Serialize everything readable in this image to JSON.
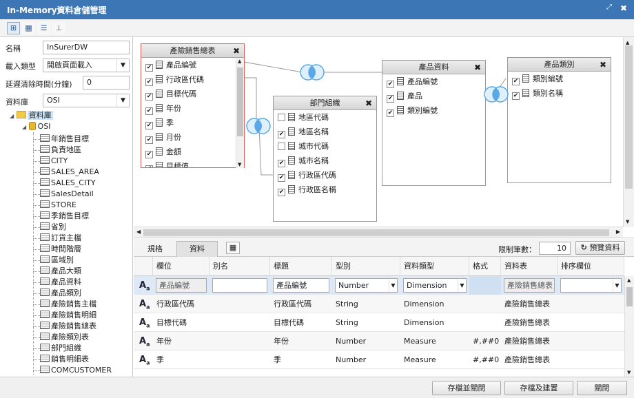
{
  "window": {
    "title": "In-Memory資料倉儲管理"
  },
  "form": {
    "name_label": "名稱",
    "name_value": "InSurerDW",
    "load_label": "載入類型",
    "load_value": "開啟頁面載入",
    "delay_label": "延遲清除時間(分鐘)",
    "delay_value": "0",
    "db_label": "資料庫",
    "db_value": "OSI"
  },
  "tree": {
    "root": "資料庫",
    "db": "OSI",
    "tables": [
      "年銷售目標",
      "負責地區",
      "CITY",
      "SALES_AREA",
      "SALES_CITY",
      "SalesDetail",
      "STORE",
      "季銷售目標",
      "省別",
      "訂貨主檔",
      "時間階層",
      "區域別",
      "產品大類",
      "產品資料",
      "產品類別",
      "產險銷售主檔",
      "產險銷售明細",
      "產險銷售總表",
      "產險類別表",
      "部門組織",
      "銷售明細表",
      "COMCUSTOMER"
    ]
  },
  "diagram": {
    "t1": {
      "title": "產險銷售總表",
      "fields": [
        [
          "產品編號",
          true
        ],
        [
          "行政區代碼",
          true
        ],
        [
          "目標代碼",
          true
        ],
        [
          "年份",
          true
        ],
        [
          "季",
          true
        ],
        [
          "月份",
          true
        ],
        [
          "金額",
          true
        ],
        [
          "目標值",
          true
        ]
      ]
    },
    "t2": {
      "title": "部門組織",
      "fields": [
        [
          "地區代碼",
          false
        ],
        [
          "地區名稱",
          true
        ],
        [
          "城市代碼",
          false
        ],
        [
          "城市名稱",
          true
        ],
        [
          "行政區代碼",
          true
        ],
        [
          "行政區名稱",
          true
        ]
      ]
    },
    "t3": {
      "title": "產品資料",
      "fields": [
        [
          "產品編號",
          true
        ],
        [
          "產品",
          true
        ],
        [
          "類別編號",
          true
        ]
      ]
    },
    "t4": {
      "title": "產品類別",
      "fields": [
        [
          "類別編號",
          true
        ],
        [
          "類別名稱",
          true
        ]
      ]
    }
  },
  "bottom": {
    "tab_spec": "規格",
    "tab_data": "資料",
    "limit_label": "限制筆數：",
    "limit_value": "10",
    "preview_label": "預覽資料",
    "columns": [
      "欄位",
      "別名",
      "標題",
      "型別",
      "資料類型",
      "格式",
      "資料表",
      "排序欄位"
    ],
    "rows": [
      [
        "產品編號",
        "",
        "產品編號",
        "Number",
        "Dimension",
        "",
        "產險銷售總表",
        ""
      ],
      [
        "行政區代碼",
        "",
        "行政區代碼",
        "String",
        "Dimension",
        "",
        "產險銷售總表",
        ""
      ],
      [
        "目標代碼",
        "",
        "目標代碼",
        "String",
        "Dimension",
        "",
        "產險銷售總表",
        ""
      ],
      [
        "年份",
        "",
        "年份",
        "Number",
        "Measure",
        "#,##0",
        "產險銷售總表",
        ""
      ],
      [
        "季",
        "",
        "季",
        "Number",
        "Measure",
        "#,##0",
        "產險銷售總表",
        ""
      ]
    ]
  },
  "footer": {
    "save_close": "存檔並關閉",
    "save_build": "存檔及建置",
    "close": "關閉"
  },
  "colors": {
    "titlebar": "#3d76b5",
    "join": "#5aa9e6",
    "selected_border": "#e05a5a"
  }
}
